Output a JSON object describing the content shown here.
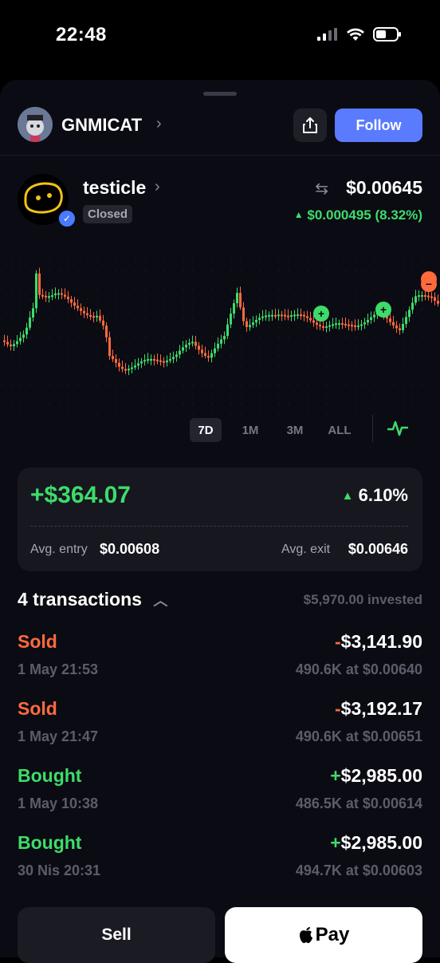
{
  "status_bar": {
    "time": "22:48"
  },
  "header": {
    "creator_name": "GNMICAT",
    "follow_label": "Follow"
  },
  "token": {
    "name": "testicle",
    "status": "Closed",
    "price": "$0.00645",
    "change": "$0.000495 (8.32%)"
  },
  "chart_ranges": [
    "7D",
    "1M",
    "3M",
    "ALL"
  ],
  "active_range": "7D",
  "pnl": {
    "value": "+$364.07",
    "percent": "6.10%",
    "avg_entry_label": "Avg. entry",
    "avg_entry": "$0.00608",
    "avg_exit_label": "Avg. exit",
    "avg_exit": "$0.00646"
  },
  "transactions": {
    "title": "4 transactions",
    "invested": "$5,970.00 invested",
    "items": [
      {
        "type": "Sold",
        "amount_sign": "-",
        "amount": "$3,141.90",
        "date": "1 May 21:53",
        "detail": "490.6K at $0.00640"
      },
      {
        "type": "Sold",
        "amount_sign": "-",
        "amount": "$3,192.17",
        "date": "1 May 21:47",
        "detail": "490.6K at $0.00651"
      },
      {
        "type": "Bought",
        "amount_sign": "+",
        "amount": "$2,985.00",
        "date": "1 May 10:38",
        "detail": "486.5K at $0.00614"
      },
      {
        "type": "Bought",
        "amount_sign": "+",
        "amount": "$2,985.00",
        "date": "30 Nis 20:31",
        "detail": "494.7K at $0.00603"
      }
    ]
  },
  "actions": {
    "sell_label": "Sell",
    "pay_label": "Pay"
  },
  "colors": {
    "green": "#3ddc6a",
    "red": "#ff6a3d",
    "accent": "#5b7bff"
  }
}
